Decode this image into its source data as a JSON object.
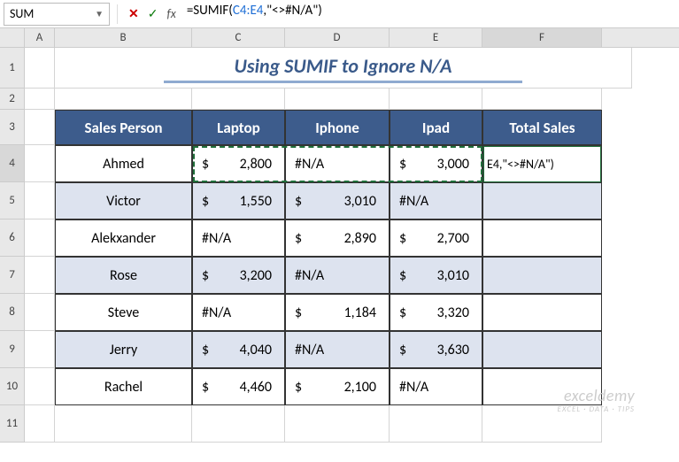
{
  "namebox": "SUM",
  "formula_display": "=SUMIF(C4:E4,\"<>#N/A\")",
  "formula_ref": "C4:E4",
  "formula_prefix": "=SUMIF(",
  "formula_suffix": ",\"<>#N/A\")",
  "title": "Using SUMIF to Ignore N/A",
  "columns": {
    "A": "A",
    "B": "B",
    "C": "C",
    "D": "D",
    "E": "E",
    "F": "F"
  },
  "rows": [
    "1",
    "2",
    "3",
    "4",
    "5",
    "6",
    "7",
    "8",
    "9",
    "10",
    "11"
  ],
  "headers": {
    "person": "Sales Person",
    "laptop": "Laptop",
    "iphone": "Iphone",
    "ipad": "Ipad",
    "total": "Total Sales"
  },
  "data": [
    {
      "person": "Ahmed",
      "laptop": "$  2,800",
      "iphone": "#N/A",
      "ipad": "$ 3,000",
      "alt": false
    },
    {
      "person": "Victor",
      "laptop": "$  1,550",
      "iphone": "$      3,010",
      "ipad": "#N/A",
      "alt": true
    },
    {
      "person": "Alekxander",
      "laptop": "#N/A",
      "iphone": "$      2,890",
      "ipad": "$ 2,700",
      "alt": false
    },
    {
      "person": "Rose",
      "laptop": "$  3,200",
      "iphone": "#N/A",
      "ipad": "$ 3,010",
      "alt": true
    },
    {
      "person": "Steve",
      "laptop": "#N/A",
      "iphone": "$      1,184",
      "ipad": "$ 3,320",
      "alt": false
    },
    {
      "person": "Jerry",
      "laptop": "$  4,040",
      "iphone": "#N/A",
      "ipad": "$ 3,630",
      "alt": true
    },
    {
      "person": "Rachel",
      "laptop": "$  4,460",
      "iphone": "$      2,100",
      "ipad": "#N/A",
      "alt": false
    }
  ],
  "active_cell_display": "E4,\"<>#N/A\")",
  "watermark": {
    "big": "exceldemy",
    "small": "EXCEL · DATA · TIPS"
  },
  "chart_data": {
    "type": "table",
    "title": "Using SUMIF to Ignore N/A",
    "columns": [
      "Sales Person",
      "Laptop",
      "Iphone",
      "Ipad",
      "Total Sales"
    ],
    "rows": [
      [
        "Ahmed",
        2800,
        null,
        3000,
        null
      ],
      [
        "Victor",
        1550,
        3010,
        null,
        null
      ],
      [
        "Alekxander",
        null,
        2890,
        2700,
        null
      ],
      [
        "Rose",
        3200,
        null,
        3010,
        null
      ],
      [
        "Steve",
        null,
        1184,
        3320,
        null
      ],
      [
        "Jerry",
        4040,
        null,
        3630,
        null
      ],
      [
        "Rachel",
        4460,
        2100,
        null,
        null
      ]
    ],
    "note": "null = #N/A error; Total Sales F4 contains formula =SUMIF(C4:E4,\"<>#N/A\")"
  }
}
